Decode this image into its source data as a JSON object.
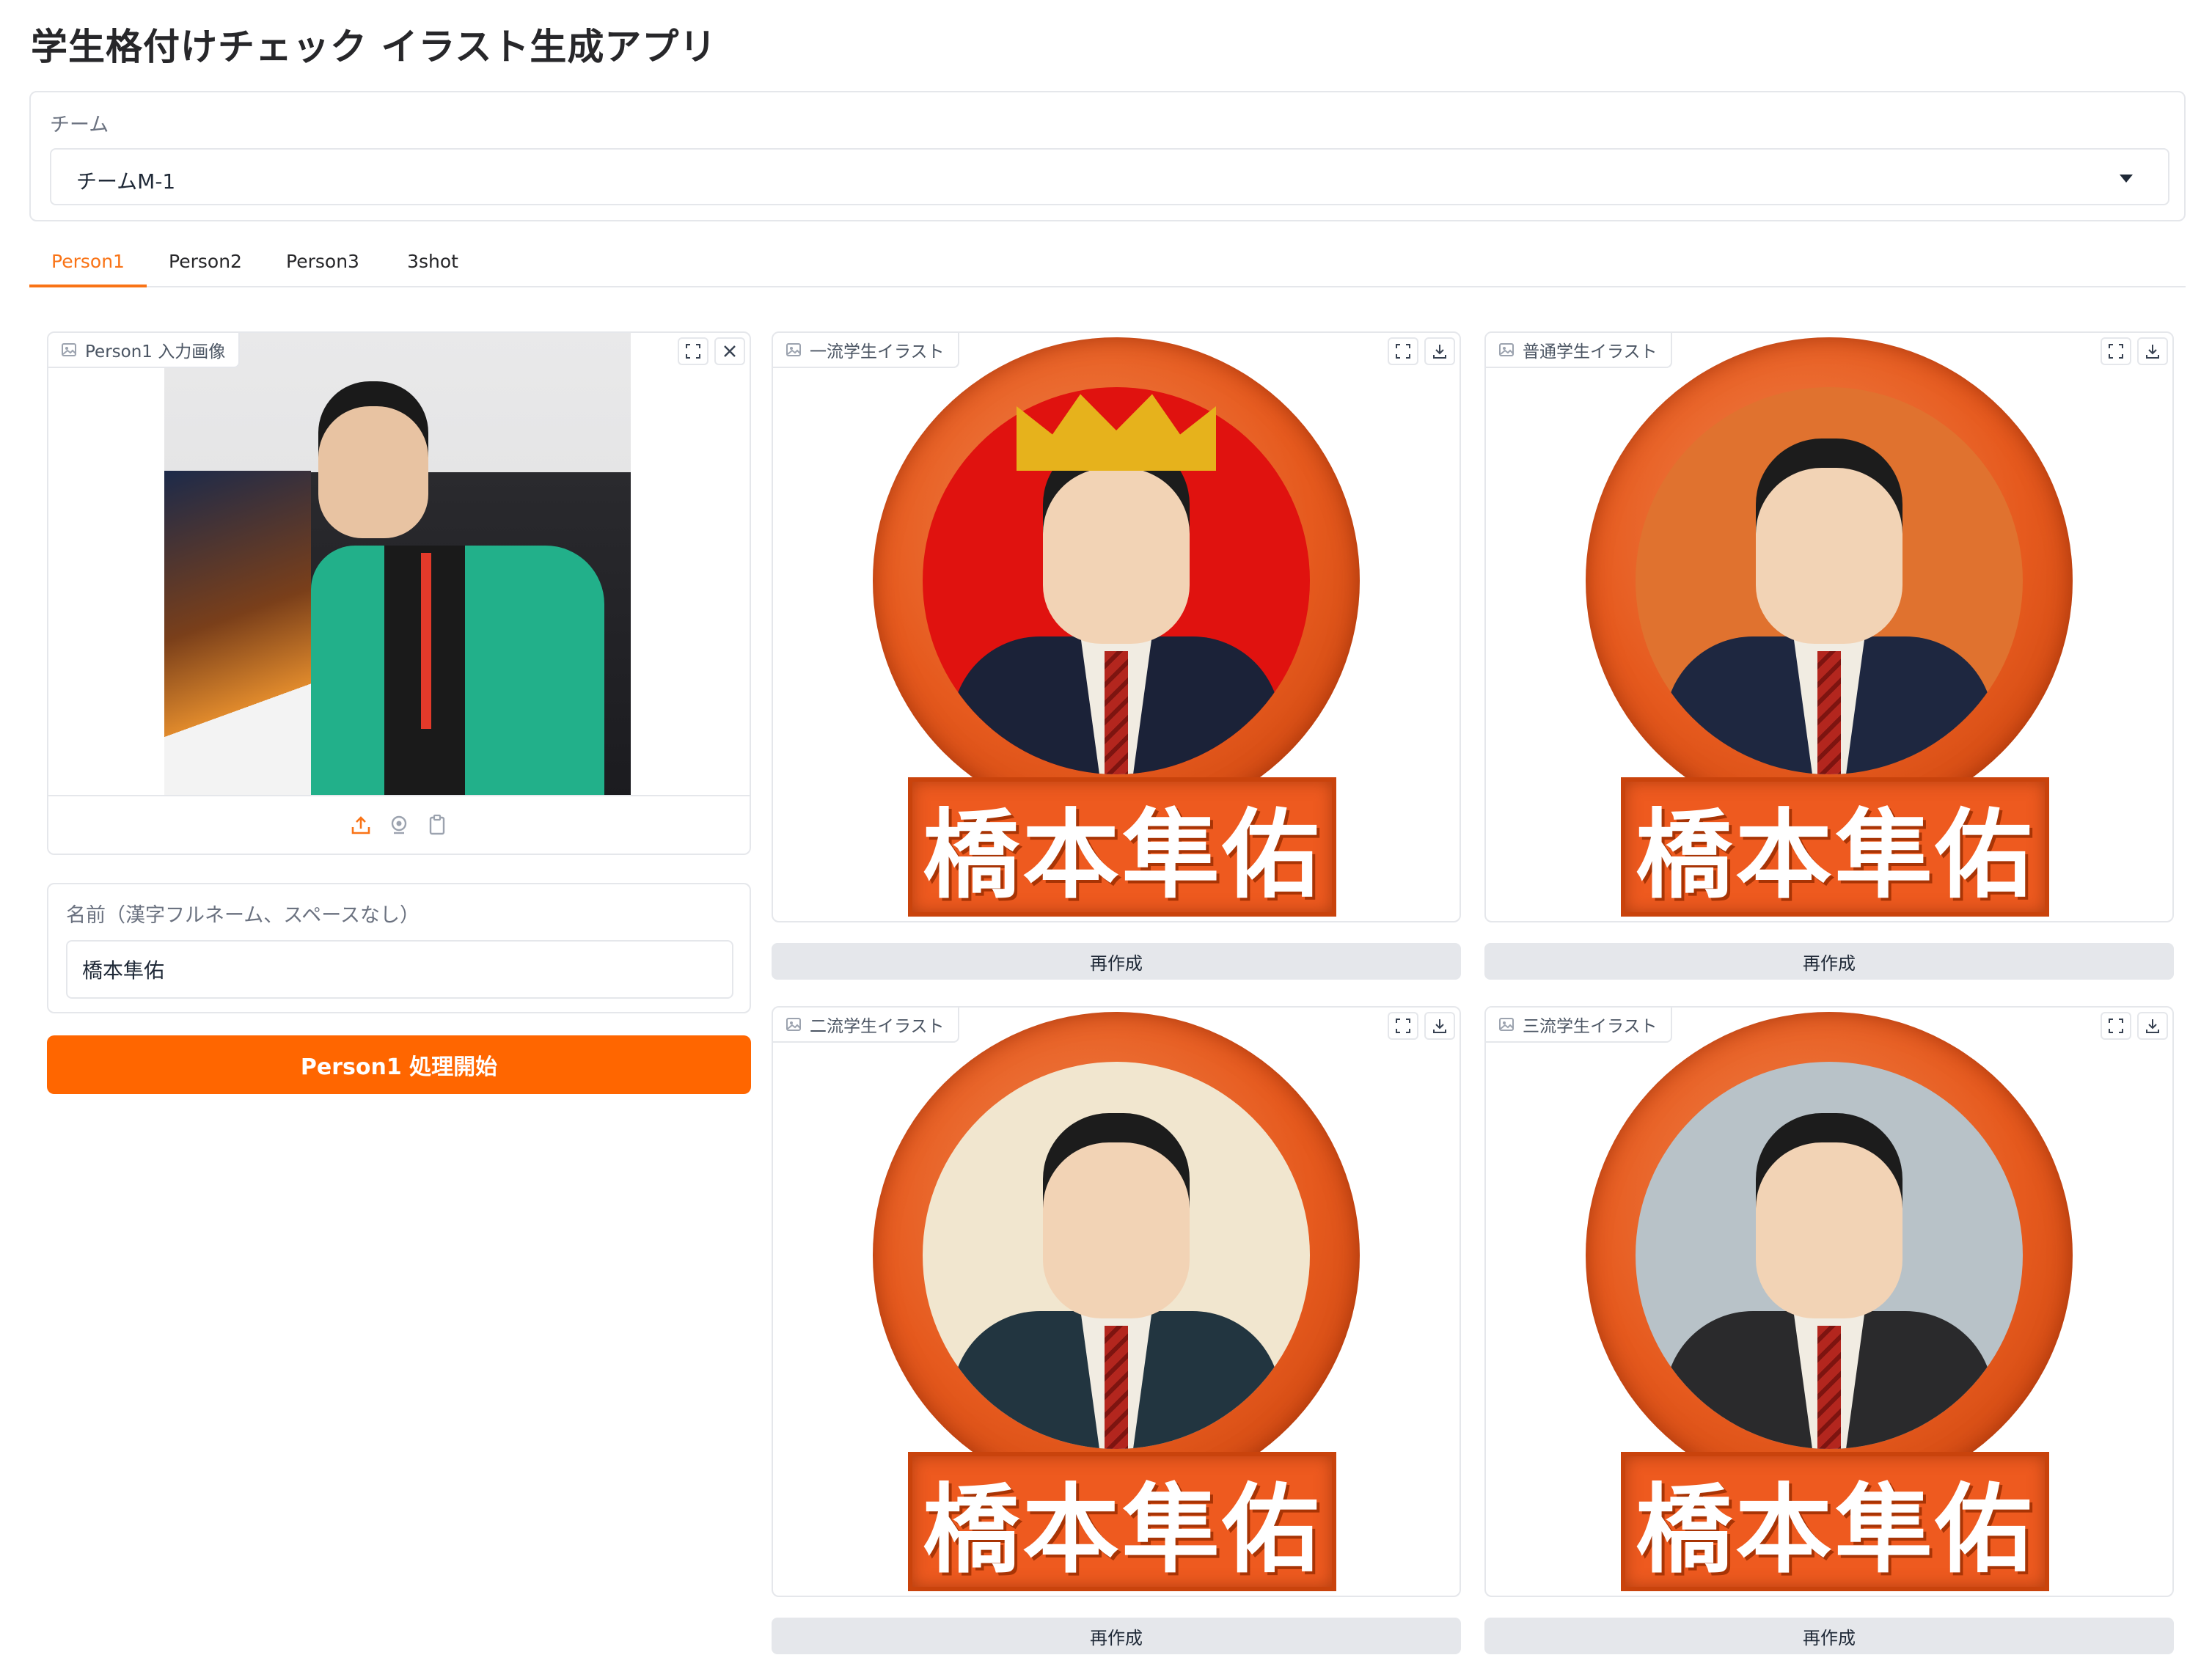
{
  "app": {
    "title": "学生格付けチェック イラスト生成アプリ"
  },
  "team": {
    "label": "チーム",
    "selected": "チームM-1"
  },
  "tabs": [
    "Person1",
    "Person2",
    "Person3",
    "3shot"
  ],
  "active_tab": "Person1",
  "input": {
    "label": "Person1 入力画像",
    "name_label": "名前（漢字フルネーム、スペースなし）",
    "name_value": "橋本隼佑",
    "start_button": "Person1 処理開始"
  },
  "outputs": [
    {
      "label": "一流学生イラスト",
      "name": "橋本隼佑",
      "bg": "#e0120f",
      "suit": "#1b2238",
      "crown": true,
      "regen": "再作成"
    },
    {
      "label": "普通学生イラスト",
      "name": "橋本隼佑",
      "bg": "#e0722f",
      "suit": "#1e2740",
      "crown": false,
      "regen": "再作成"
    },
    {
      "label": "二流学生イラスト",
      "name": "橋本隼佑",
      "bg": "#f1e6cf",
      "suit": "#223540",
      "crown": false,
      "regen": "再作成"
    },
    {
      "label": "三流学生イラスト",
      "name": "橋本隼佑",
      "bg": "#b8c2c8",
      "suit": "#2a2a2c",
      "crown": false,
      "regen": "再作成"
    }
  ],
  "colors": {
    "accent": "#ff6600",
    "tab_active": "#f97316",
    "medal": "#e65a1e"
  }
}
